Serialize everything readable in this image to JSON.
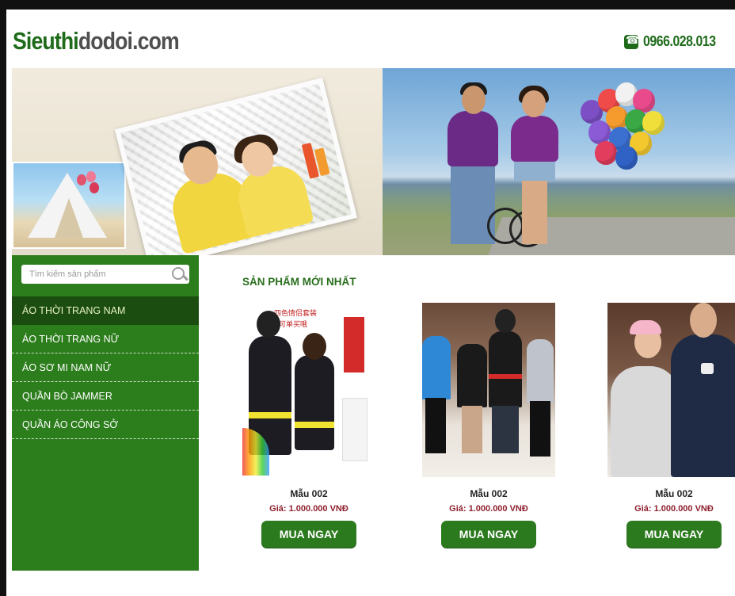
{
  "header": {
    "logo_part1": "Sieuthi",
    "logo_part2": "dodoi.com",
    "hotline": "0966.028.013"
  },
  "search": {
    "placeholder": "Tìm kiếm sản phẩm"
  },
  "menu": {
    "items": [
      {
        "label": "ÁO THỜI TRANG NAM"
      },
      {
        "label": "ÁO THỜI TRANG NỮ"
      },
      {
        "label": "ÁO SƠ MI NAM NỮ"
      },
      {
        "label": "QUẦN BÒ JAMMER"
      },
      {
        "label": "QUẦN ÁO CÔNG SỞ"
      }
    ]
  },
  "section": {
    "title": "SẢN PHẨM MỚI NHẤT"
  },
  "products": [
    {
      "name": "Mẫu 002",
      "price": "Giá: 1.000.000 VNĐ",
      "button": "MUA NGAY",
      "image_text1": "四色情侣套装",
      "image_text2": "可单买哦"
    },
    {
      "name": "Mẫu 002",
      "price": "Giá: 1.000.000 VNĐ",
      "button": "MUA NGAY"
    },
    {
      "name": "Mẫu 002",
      "price": "Giá: 1.000.000 VNĐ",
      "button": "MUA NGAY"
    }
  ],
  "colors": {
    "brand_green": "#2c7d1c",
    "active_menu": "#1b4d10",
    "price_red": "#8e1f2e"
  }
}
